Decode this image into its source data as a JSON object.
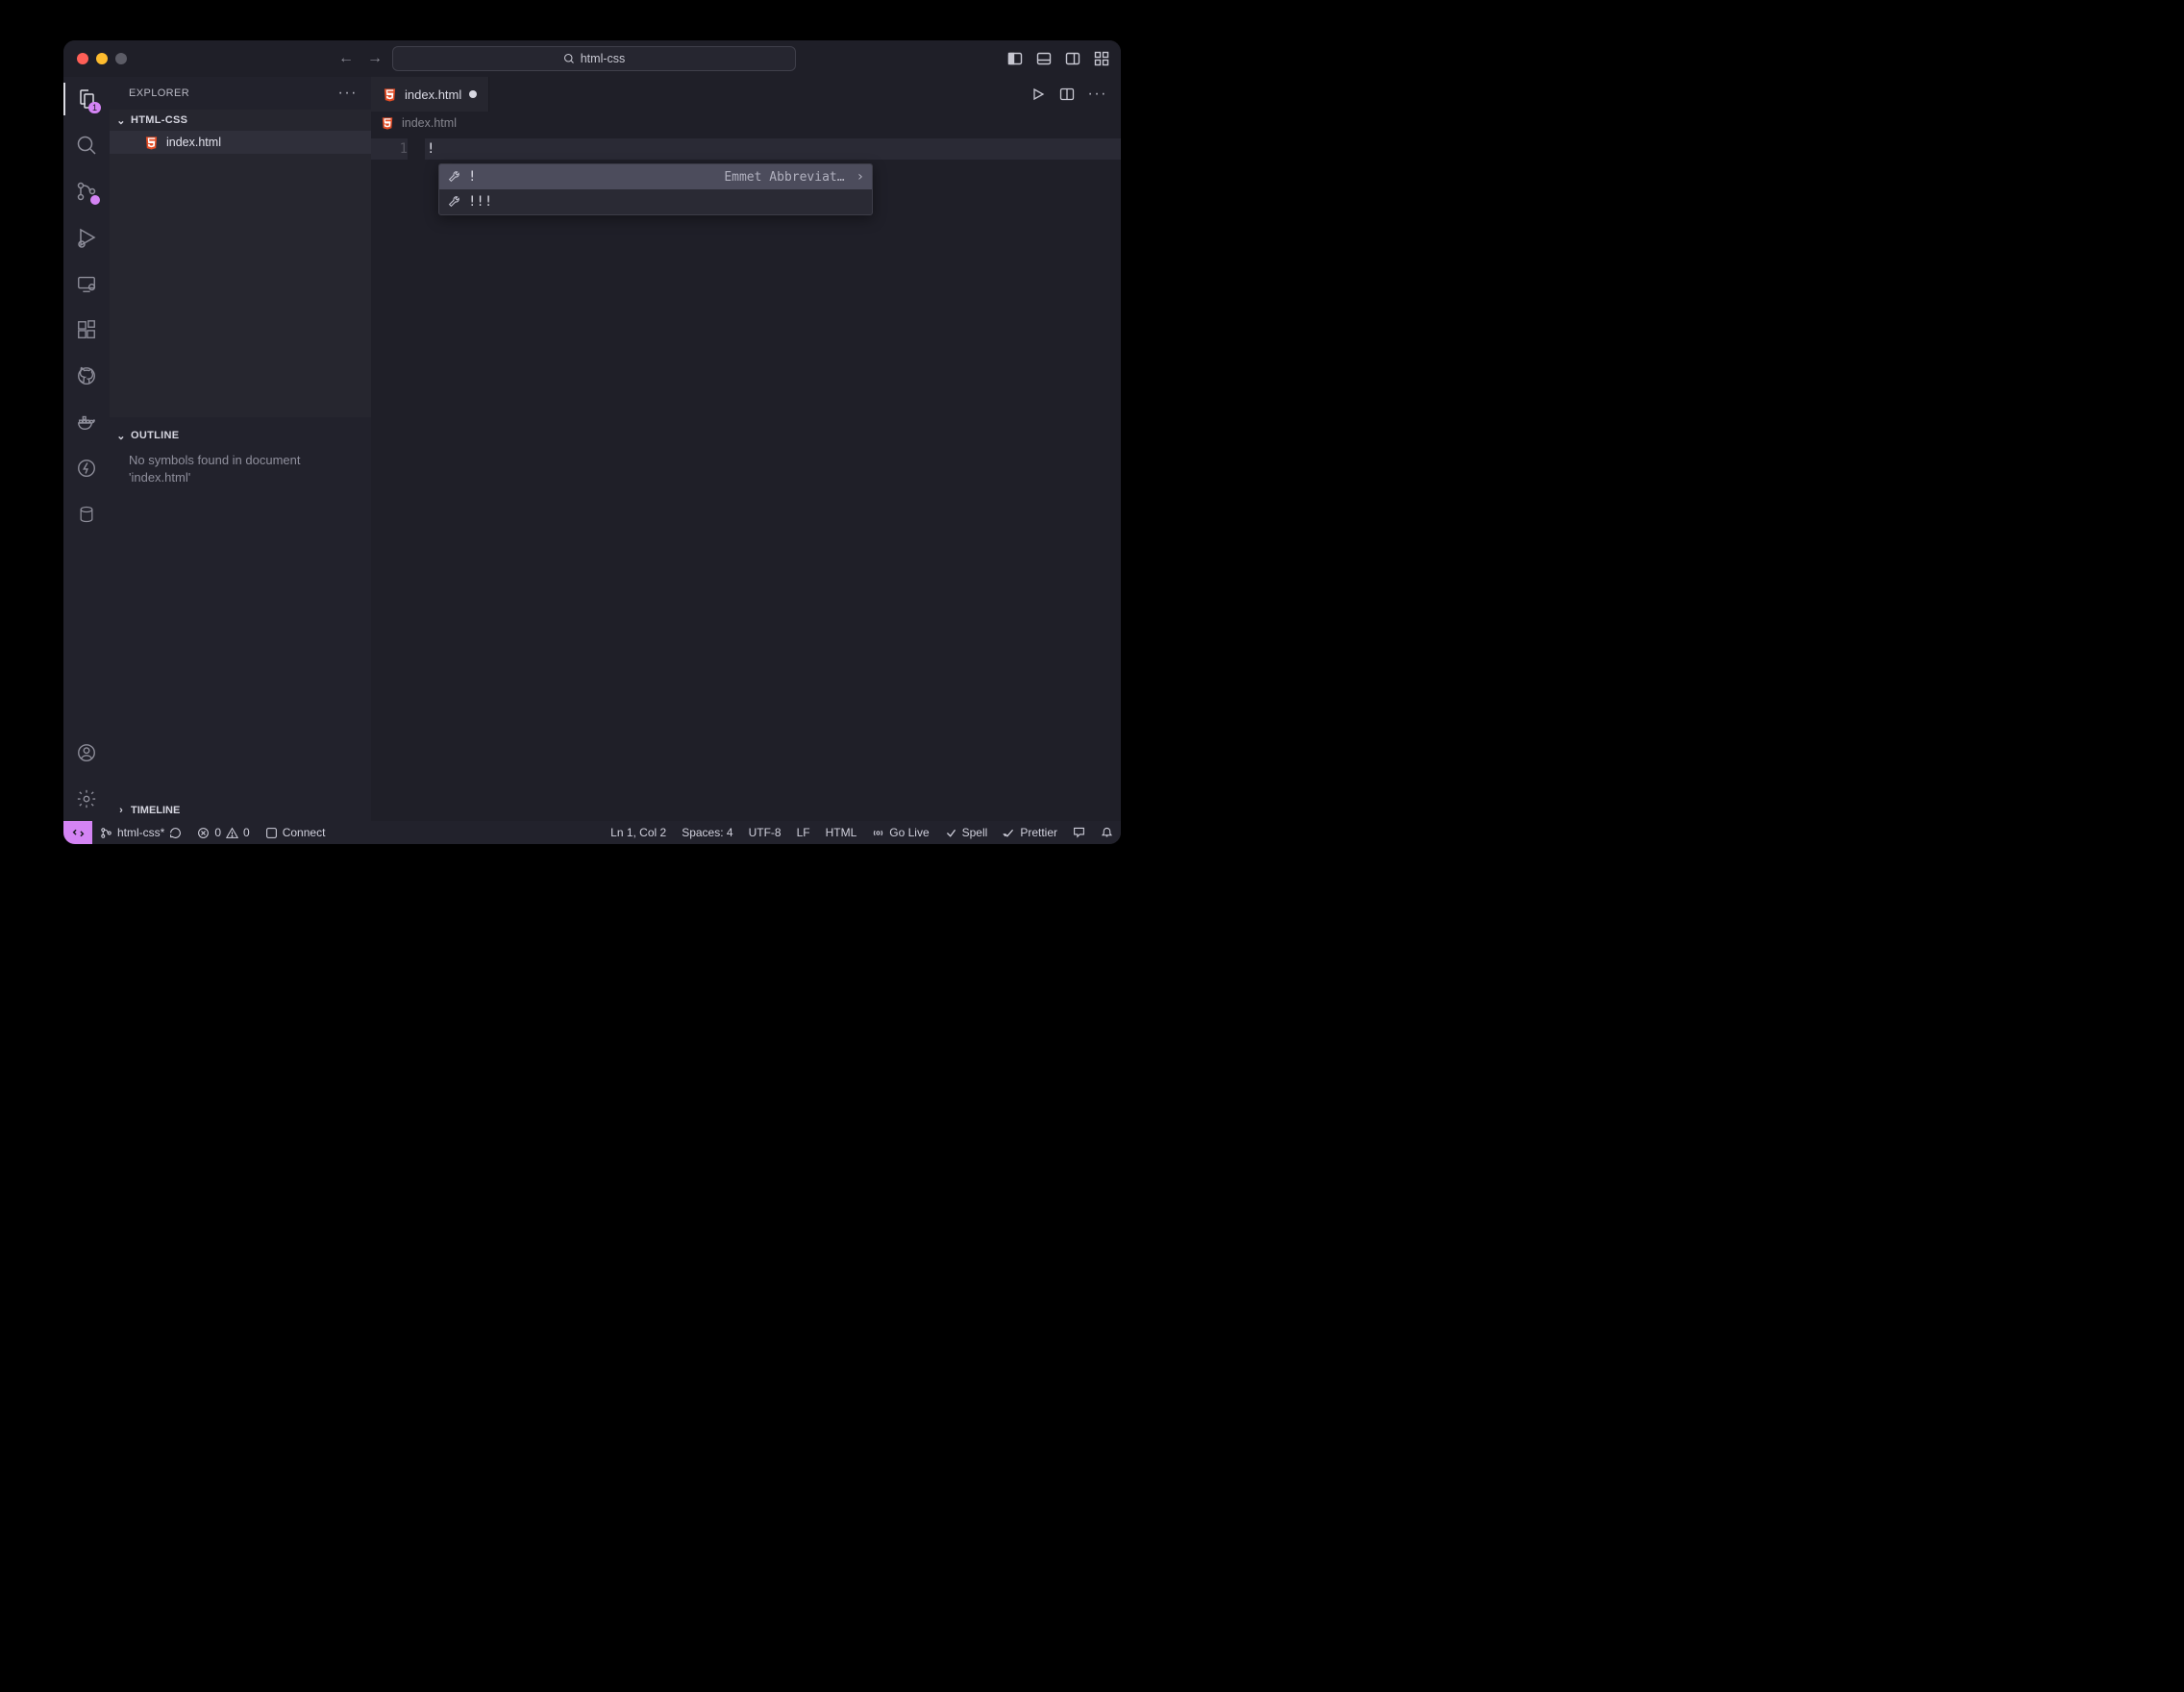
{
  "titlebar": {
    "search_label": "html-css"
  },
  "sidebar": {
    "title": "EXPLORER",
    "folder_name": "HTML-CSS",
    "files": [
      {
        "name": "index.html"
      }
    ],
    "outline_label": "OUTLINE",
    "outline_message": "No symbols found in document 'index.html'",
    "timeline_label": "TIMELINE"
  },
  "activity": {
    "explorer_badge": "1"
  },
  "editor": {
    "tab_name": "index.html",
    "breadcrumb": "index.html",
    "line_numbers": [
      "1"
    ],
    "line_content": "!",
    "suggest": {
      "row1": "!",
      "row1_hint": "Emmet Abbreviat…",
      "row2": "!!!"
    }
  },
  "status": {
    "branch": "html-css*",
    "errors": "0",
    "warnings": "0",
    "connect": "Connect",
    "cursor": "Ln 1, Col 2",
    "spaces": "Spaces: 4",
    "encoding": "UTF-8",
    "eol": "LF",
    "lang": "HTML",
    "golive": "Go Live",
    "spell": "Spell",
    "prettier": "Prettier"
  }
}
